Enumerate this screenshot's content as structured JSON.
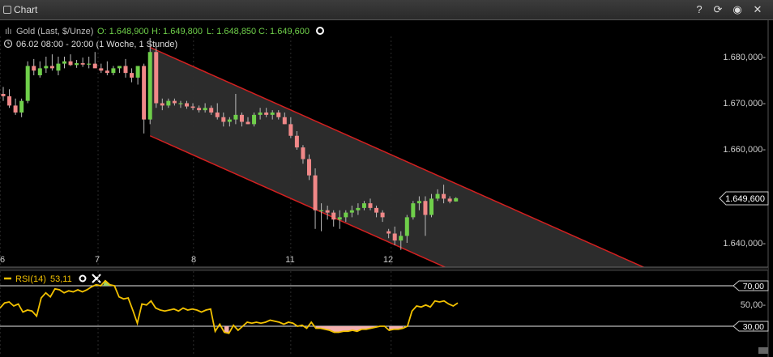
{
  "window": {
    "title": "Chart"
  },
  "toolbar": {
    "help": "?",
    "reload": "⟳",
    "settings": "◉",
    "close": "✕"
  },
  "instrument": {
    "name": "Gold (Last, $/Unze)",
    "open": "O: 1.648,900",
    "high": "H: 1.649,800",
    "low": "L: 1.648,850",
    "close": "C: 1.649,600",
    "range": "06.02 08:00 - 20:00 (1 Woche, 1 Stunde)"
  },
  "price_axis": {
    "ticks": [
      "1.680,000-",
      "1.670,000-",
      "1.660,000-",
      "1.650,000-",
      "1.640,000-"
    ],
    "current_label": "1.649,600"
  },
  "rsi": {
    "label": "RSI(14)",
    "value": "53,11",
    "axis_ticks": [
      "50,00-"
    ],
    "upper_label": "70,00",
    "lower_label": "30,00"
  },
  "colors": {
    "up": "#6fcf4a",
    "down": "#f08888",
    "channel": "#d42020",
    "rsi": "#f2c100",
    "rsi_fill": "#f4b0b0"
  },
  "chart_data": [
    {
      "type": "candlestick",
      "x_tick_labels": [
        "6",
        "7",
        "8",
        "11",
        "12"
      ],
      "ylim": [
        1635,
        1686
      ],
      "candles": [
        {
          "o": 1672,
          "h": 1673.5,
          "l": 1670.5,
          "c": 1671.5
        },
        {
          "o": 1671.5,
          "h": 1673,
          "l": 1669,
          "c": 1669.5
        },
        {
          "o": 1669.5,
          "h": 1671,
          "l": 1667.5,
          "c": 1668
        },
        {
          "o": 1668,
          "h": 1671,
          "l": 1667,
          "c": 1670.5
        },
        {
          "o": 1670.5,
          "h": 1679,
          "l": 1670,
          "c": 1678
        },
        {
          "o": 1678,
          "h": 1679.5,
          "l": 1676,
          "c": 1677
        },
        {
          "o": 1676,
          "h": 1679,
          "l": 1675.5,
          "c": 1677.5
        },
        {
          "o": 1677.5,
          "h": 1680,
          "l": 1676.5,
          "c": 1678
        },
        {
          "o": 1678,
          "h": 1680.5,
          "l": 1677,
          "c": 1677.5
        },
        {
          "o": 1677,
          "h": 1680,
          "l": 1676,
          "c": 1678.5
        },
        {
          "o": 1678.5,
          "h": 1680,
          "l": 1677.5,
          "c": 1679
        },
        {
          "o": 1679,
          "h": 1680.5,
          "l": 1678,
          "c": 1678.2
        },
        {
          "o": 1678.2,
          "h": 1679.3,
          "l": 1677.6,
          "c": 1678.6
        },
        {
          "o": 1678.6,
          "h": 1679.8,
          "l": 1677.8,
          "c": 1678.3
        },
        {
          "o": 1678.3,
          "h": 1680,
          "l": 1677.5,
          "c": 1678.5
        },
        {
          "o": 1678.5,
          "h": 1681,
          "l": 1678,
          "c": 1677.5
        },
        {
          "o": 1677.5,
          "h": 1678.5,
          "l": 1676.5,
          "c": 1677
        },
        {
          "o": 1677,
          "h": 1679,
          "l": 1676,
          "c": 1676.5
        },
        {
          "o": 1676.5,
          "h": 1678,
          "l": 1676,
          "c": 1677.5
        },
        {
          "o": 1677.5,
          "h": 1678,
          "l": 1676.5,
          "c": 1678
        },
        {
          "o": 1678,
          "h": 1679.5,
          "l": 1675.5,
          "c": 1676.5
        },
        {
          "o": 1676.5,
          "h": 1677.5,
          "l": 1674.5,
          "c": 1675.5
        },
        {
          "o": 1675.5,
          "h": 1678,
          "l": 1674,
          "c": 1678
        },
        {
          "o": 1678,
          "h": 1678.5,
          "l": 1663.5,
          "c": 1666.5
        },
        {
          "o": 1666.5,
          "h": 1684,
          "l": 1665.5,
          "c": 1681
        },
        {
          "o": 1681,
          "h": 1683,
          "l": 1669,
          "c": 1670
        },
        {
          "o": 1670,
          "h": 1671,
          "l": 1668.5,
          "c": 1669.5
        },
        {
          "o": 1669.5,
          "h": 1671,
          "l": 1669,
          "c": 1670.5
        },
        {
          "o": 1670.5,
          "h": 1671,
          "l": 1669.5,
          "c": 1670
        },
        {
          "o": 1670,
          "h": 1670.5,
          "l": 1669,
          "c": 1670
        },
        {
          "o": 1670,
          "h": 1670.5,
          "l": 1668.8,
          "c": 1669.3
        },
        {
          "o": 1669.3,
          "h": 1670,
          "l": 1668.5,
          "c": 1669
        },
        {
          "o": 1669,
          "h": 1669.5,
          "l": 1668,
          "c": 1668.5
        },
        {
          "o": 1668.5,
          "h": 1670,
          "l": 1668,
          "c": 1669
        },
        {
          "o": 1669,
          "h": 1669.5,
          "l": 1667.5,
          "c": 1668
        },
        {
          "o": 1668,
          "h": 1670,
          "l": 1666.5,
          "c": 1667
        },
        {
          "o": 1667,
          "h": 1668,
          "l": 1665,
          "c": 1666
        },
        {
          "o": 1666,
          "h": 1667,
          "l": 1665,
          "c": 1666.5
        },
        {
          "o": 1666.5,
          "h": 1672,
          "l": 1665.5,
          "c": 1667.5
        },
        {
          "o": 1667.5,
          "h": 1668,
          "l": 1665,
          "c": 1666
        },
        {
          "o": 1666,
          "h": 1667,
          "l": 1665.5,
          "c": 1665.5
        },
        {
          "o": 1665.5,
          "h": 1668,
          "l": 1665,
          "c": 1667.5
        },
        {
          "o": 1667.5,
          "h": 1669,
          "l": 1666.5,
          "c": 1668
        },
        {
          "o": 1668,
          "h": 1669,
          "l": 1667,
          "c": 1667.5
        },
        {
          "o": 1667.5,
          "h": 1668.5,
          "l": 1666.5,
          "c": 1668
        },
        {
          "o": 1668,
          "h": 1668.5,
          "l": 1666.5,
          "c": 1667
        },
        {
          "o": 1667,
          "h": 1668,
          "l": 1665.5,
          "c": 1665.5
        },
        {
          "o": 1665.5,
          "h": 1667,
          "l": 1662.5,
          "c": 1663
        },
        {
          "o": 1663,
          "h": 1664,
          "l": 1660,
          "c": 1660.5
        },
        {
          "o": 1660.5,
          "h": 1661,
          "l": 1657,
          "c": 1658
        },
        {
          "o": 1658,
          "h": 1659,
          "l": 1653.5,
          "c": 1654.5
        },
        {
          "o": 1654.5,
          "h": 1656,
          "l": 1643,
          "c": 1647
        },
        {
          "o": 1647,
          "h": 1648.5,
          "l": 1642.5,
          "c": 1647
        },
        {
          "o": 1647,
          "h": 1648,
          "l": 1645,
          "c": 1646.5
        },
        {
          "o": 1646.5,
          "h": 1647,
          "l": 1643.5,
          "c": 1645
        },
        {
          "o": 1645,
          "h": 1647,
          "l": 1643,
          "c": 1645.5
        },
        {
          "o": 1645.5,
          "h": 1647,
          "l": 1644.5,
          "c": 1646.5
        },
        {
          "o": 1646.5,
          "h": 1648,
          "l": 1645.5,
          "c": 1647
        },
        {
          "o": 1647,
          "h": 1648.5,
          "l": 1646,
          "c": 1647.5
        },
        {
          "o": 1647.5,
          "h": 1649,
          "l": 1647,
          "c": 1648.5
        },
        {
          "o": 1648.5,
          "h": 1649.5,
          "l": 1647,
          "c": 1647.5
        },
        {
          "o": 1647.5,
          "h": 1648,
          "l": 1645.5,
          "c": 1646.5
        },
        {
          "o": 1646.5,
          "h": 1647,
          "l": 1644.5,
          "c": 1645.5
        },
        {
          "o": 1642.5,
          "h": 1643,
          "l": 1641,
          "c": 1642
        },
        {
          "o": 1642,
          "h": 1643.5,
          "l": 1639.5,
          "c": 1640.5
        },
        {
          "o": 1640.5,
          "h": 1642.5,
          "l": 1638.5,
          "c": 1641.5
        },
        {
          "o": 1641.5,
          "h": 1646,
          "l": 1640,
          "c": 1645.5
        },
        {
          "o": 1645.5,
          "h": 1649,
          "l": 1645,
          "c": 1648.5
        },
        {
          "o": 1648.5,
          "h": 1650,
          "l": 1647,
          "c": 1649
        },
        {
          "o": 1649,
          "h": 1650,
          "l": 1641.5,
          "c": 1646
        },
        {
          "o": 1646,
          "h": 1650.5,
          "l": 1645.5,
          "c": 1649.5
        },
        {
          "o": 1649.5,
          "h": 1651.5,
          "l": 1649,
          "c": 1650.5
        },
        {
          "o": 1650.5,
          "h": 1652.5,
          "l": 1648.5,
          "c": 1649.5
        },
        {
          "o": 1649.5,
          "h": 1650,
          "l": 1648.5,
          "c": 1648.9
        },
        {
          "o": 1648.9,
          "h": 1649.8,
          "l": 1648.85,
          "c": 1649.6
        }
      ],
      "channel": {
        "upper": [
          [
            24,
            1682
          ],
          [
            106,
            1634
          ]
        ],
        "lower": [
          [
            24,
            1663
          ],
          [
            106,
            1615
          ]
        ]
      },
      "current_price": 1649.6
    },
    {
      "type": "line",
      "name": "RSI(14)",
      "ylim": [
        20,
        78
      ],
      "upper": 70,
      "lower": 30,
      "values": [
        48,
        53,
        54,
        50,
        52,
        44,
        46,
        45,
        40,
        58,
        63,
        59,
        67,
        66,
        63,
        65,
        64,
        66,
        64,
        66,
        69,
        71,
        70,
        75,
        71,
        70,
        59,
        57,
        58,
        46,
        33,
        52,
        51,
        55,
        48,
        46,
        45,
        46,
        47,
        45,
        48,
        46,
        47,
        46,
        44,
        46,
        47,
        25,
        32,
        24,
        23,
        31,
        26,
        30,
        34,
        33,
        34,
        33,
        34,
        36,
        35,
        34,
        32,
        34,
        33,
        30,
        31,
        28,
        34,
        28,
        28,
        27,
        26,
        24,
        24,
        25,
        25,
        26,
        25,
        27,
        27,
        28,
        29,
        30,
        30,
        26,
        27,
        27,
        28,
        30,
        45,
        50,
        49,
        51,
        49,
        55,
        54,
        55,
        52,
        50,
        53
      ]
    }
  ]
}
